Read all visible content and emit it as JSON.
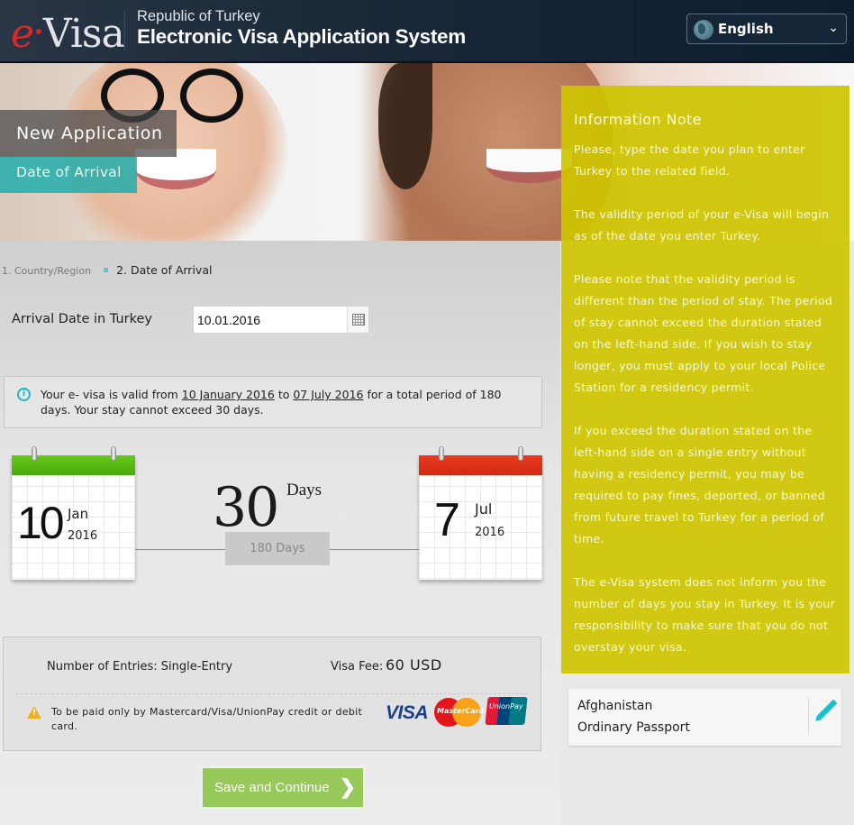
{
  "header": {
    "logo_e": "e",
    "logo_visa": "Visa",
    "subtitle": "Republic of Turkey",
    "title": "Electronic Visa Application System",
    "language": {
      "selected": "English",
      "icon": "globe-icon"
    }
  },
  "hero": {
    "title": "New Application",
    "subtitle": "Date of Arrival"
  },
  "steps": [
    {
      "label": "1. Country/Region",
      "active": false
    },
    {
      "label": "2. Date of Arrival",
      "active": true
    }
  ],
  "arrival": {
    "label": "Arrival Date in Turkey",
    "value": "10.01.2016"
  },
  "validity": {
    "prefix": "Your e- visa is valid from ",
    "start": "10 January 2016",
    "middle": " to ",
    "end": "07 July 2016",
    "suffix": " for a total period of 180 days. Your stay cannot exceed 30 days."
  },
  "calendar_start": {
    "day": "10",
    "month": "Jan",
    "year": "2016",
    "color": "#5ab814"
  },
  "calendar_end": {
    "day": "7",
    "month": "Jul",
    "year": "2016",
    "color": "#e0321a"
  },
  "stay": {
    "value": "30",
    "unit": "Days",
    "period": "180 Days"
  },
  "fee": {
    "entries": "Number of Entries: Single-Entry",
    "fee_label": "Visa Fee:",
    "fee_value": "60 USD",
    "payment_note": "To be paid only by Mastercard/Visa/UnionPay credit or debit card.",
    "cards": [
      "VISA",
      "MasterCard",
      "UnionPay"
    ]
  },
  "save_button": "Save and Continue",
  "info_note": {
    "title": "Information Note",
    "paragraphs": [
      "Please, type the date you plan to enter Turkey to the related field.",
      "The validity period of your e-Visa will begin as of the date you enter Turkey.",
      "Please note that the validity period is different than the period of stay. The period of stay cannot exceed the duration stated on the left-hand side. If you wish to stay longer, you must apply to your local Police Station for a residency permit.",
      "If you exceed the duration stated on the left-hand side on a single entry without having a residency permit, you may be required to pay fines, deported, or banned from future travel to Turkey for a period of time.",
      "The e-Visa system does not inform you the number of days you stay in Turkey. It is your responsibility to make sure that you do not overstay your visa."
    ]
  },
  "summary": {
    "country": "Afghanistan",
    "document": "Ordinary Passport"
  },
  "colors": {
    "header_bg": "#0e1e30",
    "accent_teal": "#1fb7c3",
    "note_bg": "#cec400",
    "save_button": "#97c95a"
  }
}
